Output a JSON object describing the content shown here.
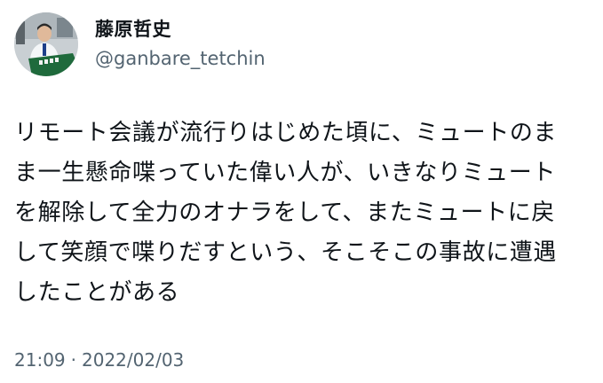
{
  "author": {
    "display_name": "藤原哲史",
    "handle": "@ganbare_tetchin",
    "avatar_icon": "profile-photo-avatar"
  },
  "tweet": {
    "lines": [
      "リモート会議が流行りはじめた頃に、ミュートのま",
      "ま一生懸命喋っていた偉い人が、いきなりミュート",
      "を解除して全力のオナラをして、またミュートに戻",
      "して笑顔で喋りだすという、そこそこの事故に遭遇",
      "したことがある"
    ]
  },
  "meta": {
    "time": "21:09",
    "separator": "·",
    "date": "2022/02/03"
  },
  "colors": {
    "text": "#0f1419",
    "secondary": "#536471",
    "background": "#ffffff"
  }
}
